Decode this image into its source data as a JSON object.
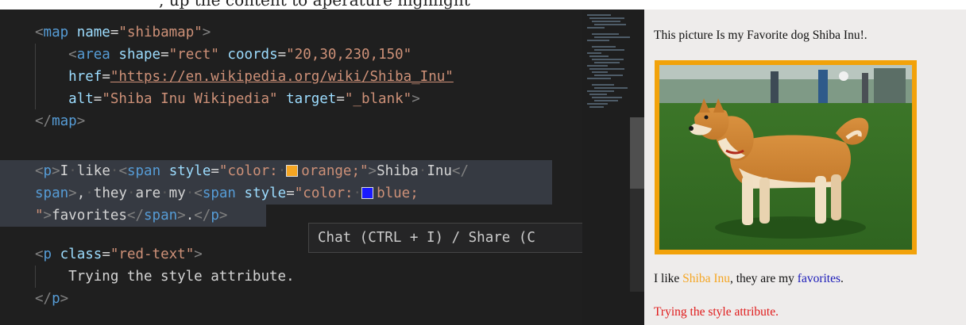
{
  "header_fragment": ", up the content to aperature highlight",
  "editor": {
    "lines": [
      [
        {
          "c": "t-punc",
          "t": "<"
        },
        {
          "c": "t-tag",
          "t": "map"
        },
        {
          "c": "t-text",
          "t": " "
        },
        {
          "c": "t-attr",
          "t": "name"
        },
        {
          "c": "t-text",
          "t": "="
        },
        {
          "c": "t-str",
          "t": "\"shibamap\""
        },
        {
          "c": "t-punc",
          "t": ">"
        }
      ],
      [
        {
          "c": "t-text",
          "t": "    "
        },
        {
          "c": "t-punc",
          "t": "<"
        },
        {
          "c": "t-tag",
          "t": "area"
        },
        {
          "c": "t-text",
          "t": " "
        },
        {
          "c": "t-attr",
          "t": "shape"
        },
        {
          "c": "t-text",
          "t": "="
        },
        {
          "c": "t-str",
          "t": "\"rect\""
        },
        {
          "c": "t-text",
          "t": " "
        },
        {
          "c": "t-attr",
          "t": "coords"
        },
        {
          "c": "t-text",
          "t": "="
        },
        {
          "c": "t-str",
          "t": "\"20,30,230,150\""
        }
      ],
      [
        {
          "c": "t-text",
          "t": "    "
        },
        {
          "c": "t-attr",
          "t": "href"
        },
        {
          "c": "t-text",
          "t": "="
        },
        {
          "c": "t-url",
          "t": "\"https://en.wikipedia.org/wiki/Shiba_Inu\""
        }
      ],
      [
        {
          "c": "t-text",
          "t": "    "
        },
        {
          "c": "t-attr",
          "t": "alt"
        },
        {
          "c": "t-text",
          "t": "="
        },
        {
          "c": "t-str",
          "t": "\"Shiba Inu Wikipedia\""
        },
        {
          "c": "t-text",
          "t": " "
        },
        {
          "c": "t-attr",
          "t": "target"
        },
        {
          "c": "t-text",
          "t": "="
        },
        {
          "c": "t-str",
          "t": "\"_blank\""
        },
        {
          "c": "t-punc",
          "t": ">"
        }
      ],
      [
        {
          "c": "t-punc",
          "t": "</"
        },
        {
          "c": "t-tag",
          "t": "map"
        },
        {
          "c": "t-punc",
          "t": ">"
        }
      ],
      [],
      [
        {
          "c": "t-punc",
          "t": "<"
        },
        {
          "c": "t-tag",
          "t": "p"
        },
        {
          "c": "t-punc",
          "t": ">"
        },
        {
          "c": "t-text",
          "t": "I"
        },
        {
          "c": "dot",
          "t": "·"
        },
        {
          "c": "t-text",
          "t": "like"
        },
        {
          "c": "dot",
          "t": "·"
        },
        {
          "c": "t-punc",
          "t": "<"
        },
        {
          "c": "t-tag",
          "t": "span"
        },
        {
          "c": "t-text",
          "t": " "
        },
        {
          "c": "t-attr",
          "t": "style"
        },
        {
          "c": "t-text",
          "t": "="
        },
        {
          "c": "t-str",
          "t": "\"color:"
        },
        {
          "c": "dot",
          "t": "·"
        },
        {
          "swatch": "#f5a623"
        },
        {
          "c": "t-str",
          "t": "orange;\""
        },
        {
          "c": "t-punc",
          "t": ">"
        },
        {
          "c": "t-text",
          "t": "Shiba"
        },
        {
          "c": "dot",
          "t": "·"
        },
        {
          "c": "t-text",
          "t": "Inu"
        },
        {
          "c": "t-punc",
          "t": "</"
        }
      ],
      [
        {
          "c": "t-tag",
          "t": "span"
        },
        {
          "c": "t-punc",
          "t": ">"
        },
        {
          "c": "t-text",
          "t": ","
        },
        {
          "c": "dot",
          "t": "·"
        },
        {
          "c": "t-text",
          "t": "they"
        },
        {
          "c": "dot",
          "t": "·"
        },
        {
          "c": "t-text",
          "t": "are"
        },
        {
          "c": "dot",
          "t": "·"
        },
        {
          "c": "t-text",
          "t": "my"
        },
        {
          "c": "dot",
          "t": "·"
        },
        {
          "c": "t-punc",
          "t": "<"
        },
        {
          "c": "t-tag",
          "t": "span"
        },
        {
          "c": "t-text",
          "t": " "
        },
        {
          "c": "t-attr",
          "t": "style"
        },
        {
          "c": "t-text",
          "t": "="
        },
        {
          "c": "t-str",
          "t": "\"color:"
        },
        {
          "c": "dot",
          "t": "·"
        },
        {
          "swatch": "#1a1aff"
        },
        {
          "c": "t-str",
          "t": "blue;"
        }
      ],
      [
        {
          "c": "t-str",
          "t": "\""
        },
        {
          "c": "t-punc",
          "t": ">"
        },
        {
          "c": "t-text",
          "t": "favorites"
        },
        {
          "c": "t-punc",
          "t": "</"
        },
        {
          "c": "t-tag",
          "t": "span"
        },
        {
          "c": "t-punc",
          "t": ">"
        },
        {
          "c": "t-text",
          "t": "."
        },
        {
          "c": "t-punc",
          "t": "</"
        },
        {
          "c": "t-tag",
          "t": "p"
        },
        {
          "c": "t-punc",
          "t": ">"
        }
      ],
      [],
      [
        {
          "c": "t-punc",
          "t": "<"
        },
        {
          "c": "t-tag",
          "t": "p"
        },
        {
          "c": "t-text",
          "t": " "
        },
        {
          "c": "t-attr",
          "t": "class"
        },
        {
          "c": "t-text",
          "t": "="
        },
        {
          "c": "t-str",
          "t": "\"red-text\""
        },
        {
          "c": "t-punc",
          "t": ">"
        }
      ],
      [
        {
          "c": "t-text",
          "t": "    Trying the style attribute."
        }
      ],
      [
        {
          "c": "t-punc",
          "t": "</"
        },
        {
          "c": "t-tag",
          "t": "p"
        },
        {
          "c": "t-punc",
          "t": ">"
        }
      ]
    ],
    "highlighted_lines": [
      6,
      7,
      8
    ],
    "tooltip": "Chat (CTRL + I) / Share (C"
  },
  "preview": {
    "intro": "This picture Is my Favorite dog Shiba Inu!.",
    "image_alt": "Shiba Inu Wikipedia",
    "sentence_prefix": "I like ",
    "sentence_orange": "Shiba Inu",
    "sentence_middle": ", they are my ",
    "sentence_blue": "favorites",
    "sentence_suffix": ".",
    "red_text": "Trying the style attribute."
  },
  "colors": {
    "editor_bg": "#1f1f1f",
    "orange": "#f5a623",
    "blue": "#1a1ab8",
    "red": "#e01b1b",
    "frame": "#f2a20a"
  }
}
